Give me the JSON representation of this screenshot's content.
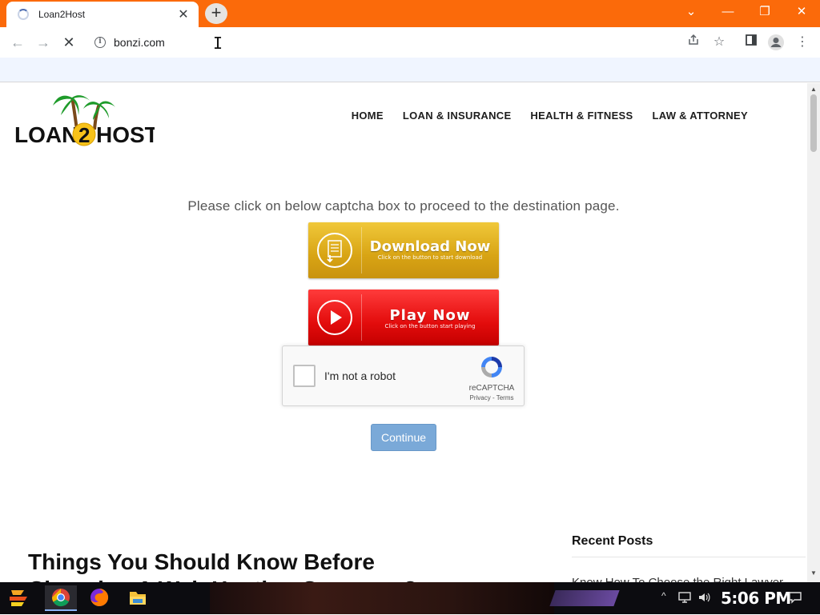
{
  "browser": {
    "tab_title": "Loan2Host",
    "tab_close": "✕",
    "new_tab": "+",
    "url": "bonzi.com",
    "controls": {
      "collapse": "⌄",
      "minimize": "—",
      "restore": "❐",
      "close": "✕"
    },
    "accent": "#fb6a0a"
  },
  "site": {
    "logo_text_left": "LOAN",
    "logo_digit": "2",
    "logo_text_right": "HOST",
    "nav": [
      "HOME",
      "LOAN & INSURANCE",
      "HEALTH & FITNESS",
      "LAW & ATTORNEY"
    ]
  },
  "main": {
    "prompt": "Please click on below captcha box to proceed to the destination page.",
    "download": {
      "label": "Download Now",
      "sub": "Click on the button to start download"
    },
    "play": {
      "label": "Play Now",
      "sub": "Click on the button start playing"
    },
    "captcha": {
      "label": "I'm not a robot",
      "brand": "reCAPTCHA",
      "terms": "Privacy - Terms"
    },
    "continue_label": "Continue"
  },
  "article": {
    "title": "Things You Should Know Before Choosing A Web Hosting Company?"
  },
  "sidebar": {
    "recent_title": "Recent Posts",
    "first_item": "Know How To Choose the Right Lawyer"
  },
  "taskbar": {
    "clock": "5:06 PM"
  }
}
